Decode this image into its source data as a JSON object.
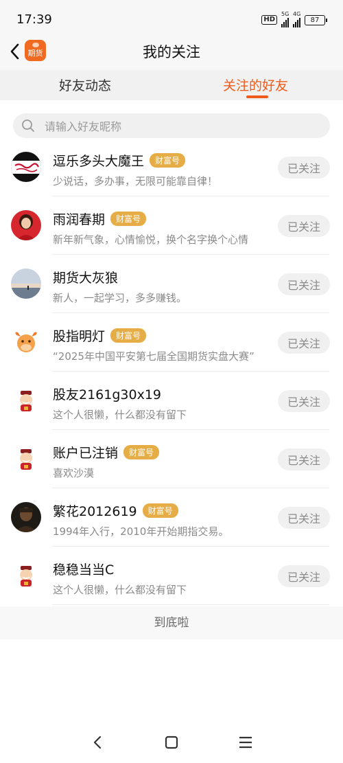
{
  "status": {
    "time": "17:39",
    "hd": "HD",
    "net1": "5G",
    "net2": "4G",
    "battery": "87"
  },
  "header": {
    "app_logo_text": "期货",
    "title": "我的关注"
  },
  "tabs": [
    {
      "label": "好友动态"
    },
    {
      "label": "关注的好友",
      "active": true
    }
  ],
  "search": {
    "placeholder": "请输入好友昵称"
  },
  "friends": [
    {
      "name": "逗乐多头大魔王",
      "badge": "财富号",
      "bio": "少说话，多办事，无限可能靠自律！",
      "button": "已关注",
      "avatar": "red-white-text-avatar"
    },
    {
      "name": "雨润春期",
      "badge": "财富号",
      "bio": "新年新气象，心情愉悦，换个名字换个心情",
      "button": "已关注",
      "avatar": "woman-in-red-avatar"
    },
    {
      "name": "期货大灰狼",
      "badge": "",
      "bio": "新人，一起学习，多多赚钱。",
      "button": "已关注",
      "avatar": "sunset-sea-avatar"
    },
    {
      "name": "股指明灯",
      "badge": "财富号",
      "bio": "“2025年中国平安第七届全国期货实盘大赛”",
      "button": "已关注",
      "avatar": "ox-mascot-avatar"
    },
    {
      "name": "股友2161g30x19",
      "badge": "",
      "bio": "这个人很懒，什么都没有留下",
      "button": "已关注",
      "avatar": "fortune-mascot-avatar"
    },
    {
      "name": "账户已注销",
      "badge": "财富号",
      "bio": "喜欢沙漠",
      "button": "已关注",
      "avatar": "fortune-mascot-avatar"
    },
    {
      "name": "繁花2012619",
      "badge": "财富号",
      "bio": "1994年入行，2010年开始期指交易。",
      "button": "已关注",
      "avatar": "dark-portrait-avatar"
    },
    {
      "name": "稳稳当当C",
      "badge": "",
      "bio": "这个人很懒，什么都没有留下",
      "button": "已关注",
      "avatar": "fortune-mascot-avatar"
    }
  ],
  "end_note": "到底啦",
  "colors": {
    "accent": "#f05a1a",
    "badge": "#e6ad46"
  }
}
